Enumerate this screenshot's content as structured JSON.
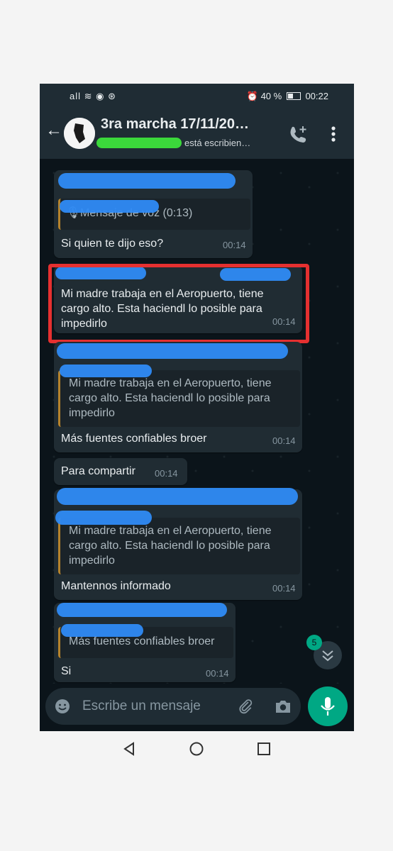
{
  "statusbar": {
    "signal": "all ≋ ◉ ⊛",
    "battery": "⏰ 40 %",
    "time": "00:22"
  },
  "header": {
    "title": "3ra marcha 17/11/20…",
    "subtitle": "está escribien…"
  },
  "messages": {
    "m1": {
      "quote": "Mensaje de voz (0:13)",
      "text": "Si quien te dijo eso?",
      "time": "00:14"
    },
    "m2": {
      "text": "Mi madre trabaja en el Aeropuerto, tiene cargo alto. Esta haciendl lo posible para impedirlo",
      "time": "00:14"
    },
    "m3": {
      "quote": "Mi madre trabaja en el Aeropuerto, tiene cargo alto. Esta haciendl lo posible para impedirlo",
      "text": "Más fuentes confiables broer",
      "time": "00:14"
    },
    "m4": {
      "text": "Para compartir",
      "time": "00:14"
    },
    "m5": {
      "quote": "Mi madre trabaja en el Aeropuerto, tiene cargo alto. Esta haciendl lo posible para impedirlo",
      "text": "Mantennos informado",
      "time": "00:14"
    },
    "m6": {
      "quote": "Más fuentes confiables broer",
      "text": "Si",
      "time": "00:14"
    }
  },
  "unread_badge": "5",
  "composer": {
    "placeholder": "Escribe un mensaje"
  },
  "icons": {
    "back": "arrow-left-icon",
    "call": "add-call-icon",
    "menu": "more-vert-icon",
    "emoji": "emoji-icon",
    "attach": "paperclip-icon",
    "camera": "camera-icon",
    "mic": "mic-icon",
    "scroll": "double-chevron-down-icon"
  },
  "colors": {
    "accent": "#00a884",
    "highlight": "#e53030"
  }
}
